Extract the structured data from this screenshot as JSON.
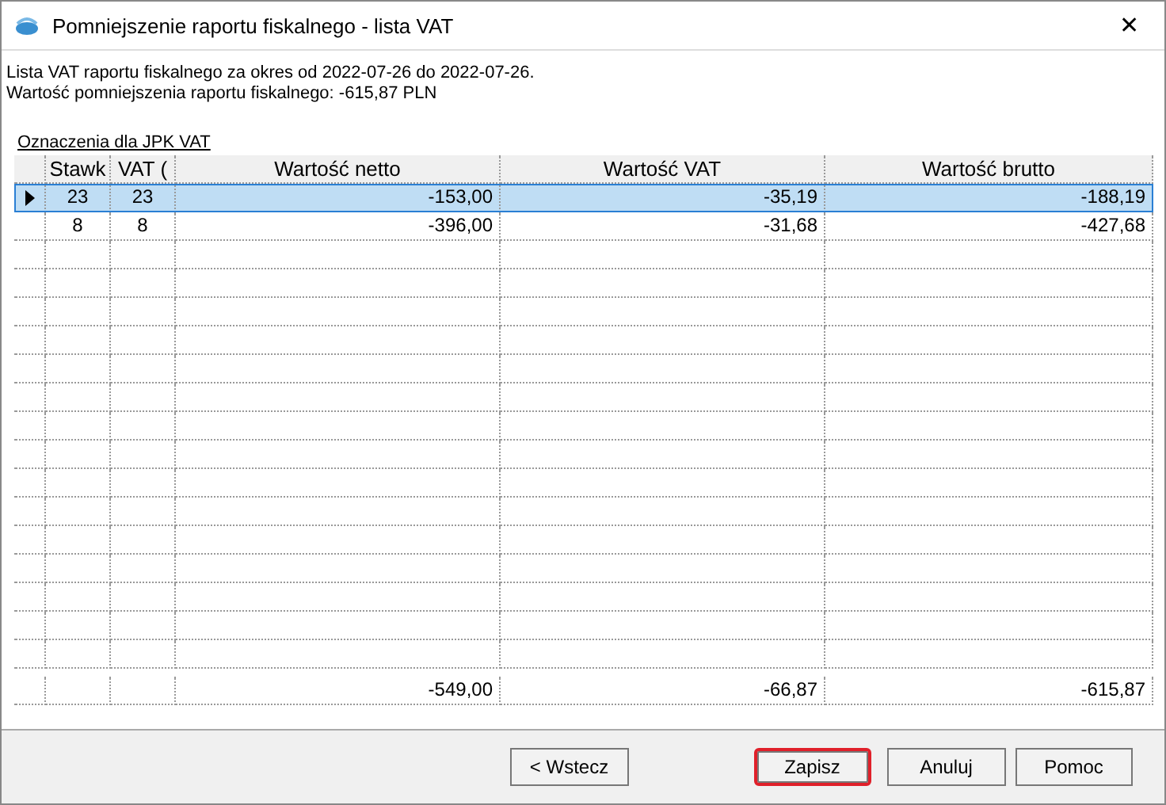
{
  "window": {
    "title": "Pomniejszenie raportu fiskalnego - lista VAT",
    "close": "✕"
  },
  "info_lines": [
    "Lista VAT raportu fiskalnego za okres od 2022-07-26 do 2022-07-26.",
    "Wartość pomniejszenia raportu fiskalnego: -615,87 PLN"
  ],
  "link": "Oznaczenia dla JPK VAT",
  "table": {
    "columns": [
      "Stawk",
      "VAT (",
      "Wartość netto",
      "Wartość VAT",
      "Wartość brutto"
    ],
    "rows": [
      {
        "cells": [
          "23",
          "23",
          "-153,00",
          "-35,19",
          "-188,19"
        ],
        "selected": true
      },
      {
        "cells": [
          "8",
          "8",
          "-396,00",
          "-31,68",
          "-427,68"
        ],
        "selected": false
      }
    ],
    "totals": [
      "-549,00",
      "-66,87",
      "-615,87"
    ]
  },
  "buttons": [
    {
      "label": "< Wstecz",
      "highlighted": false
    },
    {
      "label": "Zapisz",
      "highlighted": true
    },
    {
      "label": "Anuluj",
      "highlighted": false
    },
    {
      "label": "Pomoc",
      "highlighted": false
    }
  ]
}
